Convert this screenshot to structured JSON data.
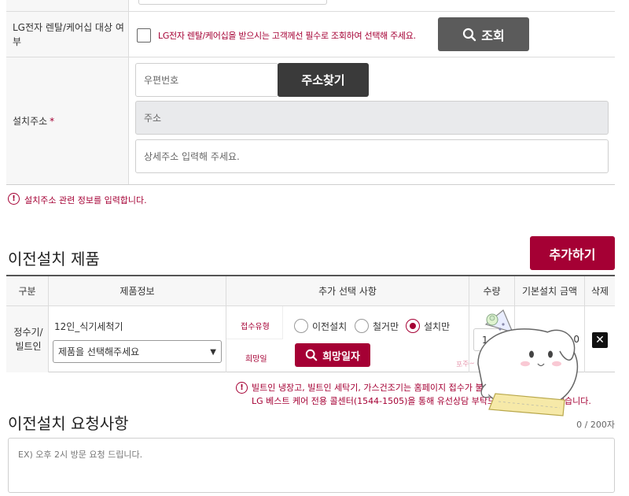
{
  "rental": {
    "label": "LG전자 렌탈/케어십 대상 여부",
    "checkbox_text": "LG전자 렌탈/케어십을 받으시는 고객께선 필수로 조회하여 선택해 주세요.",
    "lookup_button": "조회"
  },
  "address": {
    "label": "설치주소",
    "required_mark": "*",
    "postcode_placeholder": "우편번호",
    "find_button": "주소찾기",
    "address_placeholder": "주소",
    "detail_placeholder": "상세주소 입력해 주세요.",
    "info": "설치주소 관련 정보를 입력합니다."
  },
  "products": {
    "title": "이전설치 제품",
    "add_button": "추가하기",
    "headers": [
      "구분",
      "제품정보",
      "추가 선택 사항",
      "수량",
      "기본설치 금액",
      "삭제"
    ],
    "row": {
      "category": "정수기/빌트인",
      "product_name": "12인_식기세척기",
      "select_placeholder": "제품을 선택해주세요",
      "receipt_type_label": "접수유형",
      "radio_options": [
        "이전설치",
        "철거만",
        "설치만"
      ],
      "selected_option": "설치만",
      "wish_date_label": "희망일",
      "wish_date_button": "희망일자",
      "quantity": "1",
      "price": "0"
    },
    "notice_line1": "빌트인 냉장고, 빌트인 세탁기, 가스건조기는 홈페이지 접수가 불가하며,",
    "notice_line2": "LG 베스트 케어 전용 콜센터(1544-1505)을 통해 유선상담 부탁드립니다. 도와드리겠습니다."
  },
  "request": {
    "title": "이전설치 요청사항",
    "counter": "0 / 200자",
    "placeholder": "EX) 오후 2시 방문 요청 드립니다."
  },
  "mascot": {
    "caption": "포주~"
  },
  "colors": {
    "accent": "#a50034",
    "dark_button": "#3a3a3a",
    "gray_button": "#5b5b5b"
  }
}
